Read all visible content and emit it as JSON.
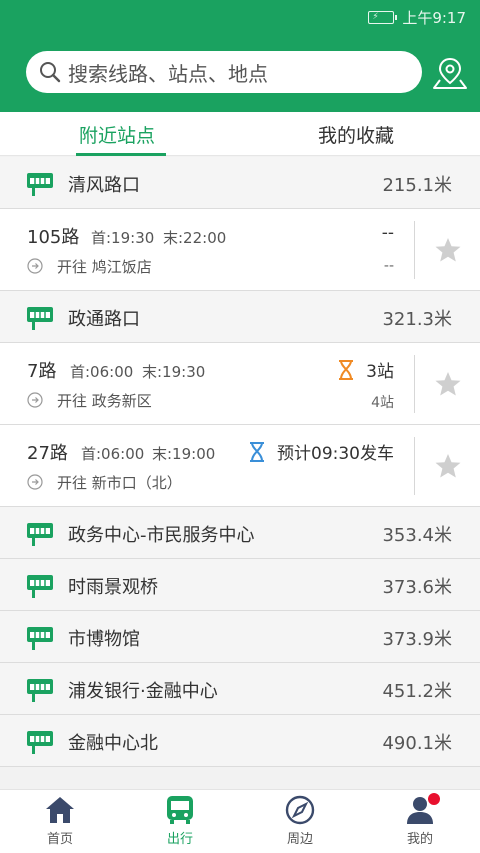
{
  "status_bar": {
    "time": "上午9:17"
  },
  "search": {
    "placeholder": "搜索线路、站点、地点"
  },
  "tabs": [
    {
      "label": "附近站点",
      "active": true
    },
    {
      "label": "我的收藏",
      "active": false
    }
  ],
  "stops": [
    {
      "name": "清风路口",
      "distance": "215.1米"
    },
    {
      "name": "政通路口",
      "distance": "321.3米"
    },
    {
      "name": "政务中心-市民服务中心",
      "distance": "353.4米"
    },
    {
      "name": "时雨景观桥",
      "distance": "373.6米"
    },
    {
      "name": "市博物馆",
      "distance": "373.9米"
    },
    {
      "name": "浦发银行·金融中心",
      "distance": "451.2米"
    },
    {
      "name": "金融中心北",
      "distance": "490.1米"
    }
  ],
  "routes": [
    {
      "name": "105路",
      "first": "首:19:30",
      "last": "末:22:00",
      "direction": "开往 鸠江饭店",
      "status": "--",
      "sub": "--"
    },
    {
      "name": "7路",
      "first": "首:06:00",
      "last": "末:19:30",
      "direction": "开往 政务新区",
      "status": "3站",
      "sub": "4站"
    },
    {
      "name": "27路",
      "first": "首:06:00",
      "last": "末:19:00",
      "direction": "开往 新市口（北）",
      "status": "预计09:30发车",
      "sub": ""
    }
  ],
  "bottom_nav": [
    {
      "label": "首页",
      "icon": "home-icon"
    },
    {
      "label": "出行",
      "icon": "bus-icon",
      "active": true
    },
    {
      "label": "周边",
      "icon": "compass-icon"
    },
    {
      "label": "我的",
      "icon": "user-icon"
    }
  ],
  "colors": {
    "brand": "#1aa260",
    "hourglass_orange": "#f08a24",
    "hourglass_blue": "#3a8fd8",
    "badge": "#e8102e"
  }
}
